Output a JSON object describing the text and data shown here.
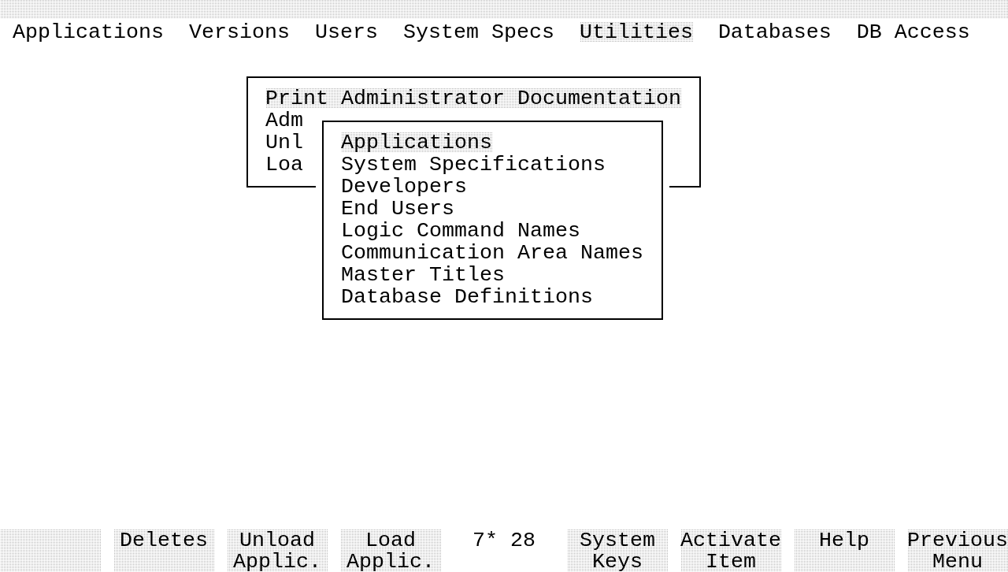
{
  "top_menu": [
    {
      "label": "Applications",
      "selected": false
    },
    {
      "label": "Versions",
      "selected": false
    },
    {
      "label": "Users",
      "selected": false
    },
    {
      "label": "System Specs",
      "selected": false
    },
    {
      "label": "Utilities",
      "selected": true
    },
    {
      "label": "Databases",
      "selected": false
    },
    {
      "label": "DB Access",
      "selected": false
    }
  ],
  "utilities_menu": {
    "items": [
      {
        "label": "Print Administrator Documentation",
        "selected": true
      },
      {
        "label": "Adm",
        "selected": false
      },
      {
        "label": "Unl",
        "selected": false
      },
      {
        "label": "Loa",
        "selected": false
      }
    ]
  },
  "submenu": {
    "items": [
      {
        "label": "Applications",
        "selected": true
      },
      {
        "label": "System Specifications",
        "selected": false
      },
      {
        "label": "Developers",
        "selected": false
      },
      {
        "label": "End Users",
        "selected": false
      },
      {
        "label": "Logic Command Names",
        "selected": false
      },
      {
        "label": "Communication Area Names",
        "selected": false
      },
      {
        "label": "Master Titles",
        "selected": false
      },
      {
        "label": "Database Definitions",
        "selected": false
      }
    ]
  },
  "function_keys": [
    {
      "kind": "blank"
    },
    {
      "kind": "key",
      "lines": [
        "Deletes"
      ]
    },
    {
      "kind": "key",
      "lines": [
        "Unload",
        "Applic."
      ]
    },
    {
      "kind": "key",
      "lines": [
        "Load",
        "Applic."
      ]
    },
    {
      "kind": "status",
      "text": "7* 28"
    },
    {
      "kind": "key",
      "lines": [
        "System",
        "Keys"
      ]
    },
    {
      "kind": "key",
      "lines": [
        "Activate",
        "Item"
      ]
    },
    {
      "kind": "key",
      "lines": [
        "Help"
      ]
    },
    {
      "kind": "key",
      "lines": [
        "Previous",
        "Menu"
      ]
    }
  ]
}
